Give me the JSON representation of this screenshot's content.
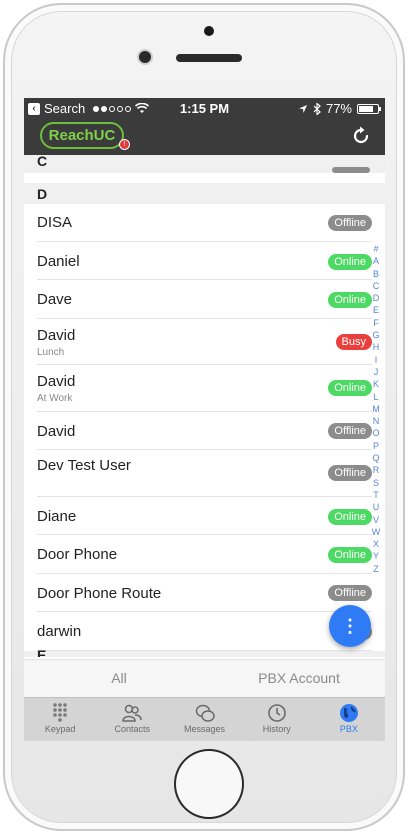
{
  "status_bar": {
    "back_label": "Search",
    "time": "1:15 PM",
    "battery": "77%"
  },
  "app": {
    "logo_text": "ReachUC",
    "logo_badge": "!"
  },
  "contacts": {
    "partial_section": "C",
    "section": "D",
    "rows": [
      {
        "name": "DISA",
        "sub": "",
        "status": "Offline",
        "type": "offline"
      },
      {
        "name": "Daniel",
        "sub": "",
        "status": "Online",
        "type": "online"
      },
      {
        "name": "Dave",
        "sub": "",
        "status": "Online",
        "type": "online"
      },
      {
        "name": "David",
        "sub": "Lunch",
        "status": "Busy",
        "type": "busy"
      },
      {
        "name": "David",
        "sub": "At Work",
        "status": "Online",
        "type": "online"
      },
      {
        "name": "David",
        "sub": "",
        "status": "Offline",
        "type": "offline"
      },
      {
        "name": "Dev Test User",
        "sub": "",
        "status": "Offline",
        "type": "offline"
      },
      {
        "name": "Diane",
        "sub": "",
        "status": "Online",
        "type": "online"
      },
      {
        "name": "Door Phone",
        "sub": "",
        "status": "Online",
        "type": "online"
      },
      {
        "name": "Door Phone Route",
        "sub": "",
        "status": "Offline",
        "type": "offline"
      },
      {
        "name": "darwin",
        "sub": "",
        "status": "",
        "type": "offline"
      }
    ],
    "next_section": "E"
  },
  "index_letters": [
    "#",
    "A",
    "B",
    "C",
    "D",
    "E",
    "F",
    "G",
    "H",
    "I",
    "J",
    "K",
    "L",
    "M",
    "N",
    "O",
    "P",
    "Q",
    "R",
    "S",
    "T",
    "U",
    "V",
    "W",
    "X",
    "Y",
    "Z"
  ],
  "fab": {
    "icon": "more-vertical-icon",
    "symbol": "⋮"
  },
  "filter": {
    "all": "All",
    "pbx": "PBX Account"
  },
  "tabs": [
    {
      "label": "Keypad",
      "icon": "keypad-icon"
    },
    {
      "label": "Contacts",
      "icon": "contacts-icon"
    },
    {
      "label": "Messages",
      "icon": "messages-icon"
    },
    {
      "label": "History",
      "icon": "history-icon"
    },
    {
      "label": "PBX",
      "icon": "globe-icon",
      "active": true
    }
  ],
  "colors": {
    "online": "#4cd964",
    "offline": "#8c8c8c",
    "busy": "#e8403d",
    "accent": "#2f7bf5",
    "brand": "#6bbf3a"
  }
}
